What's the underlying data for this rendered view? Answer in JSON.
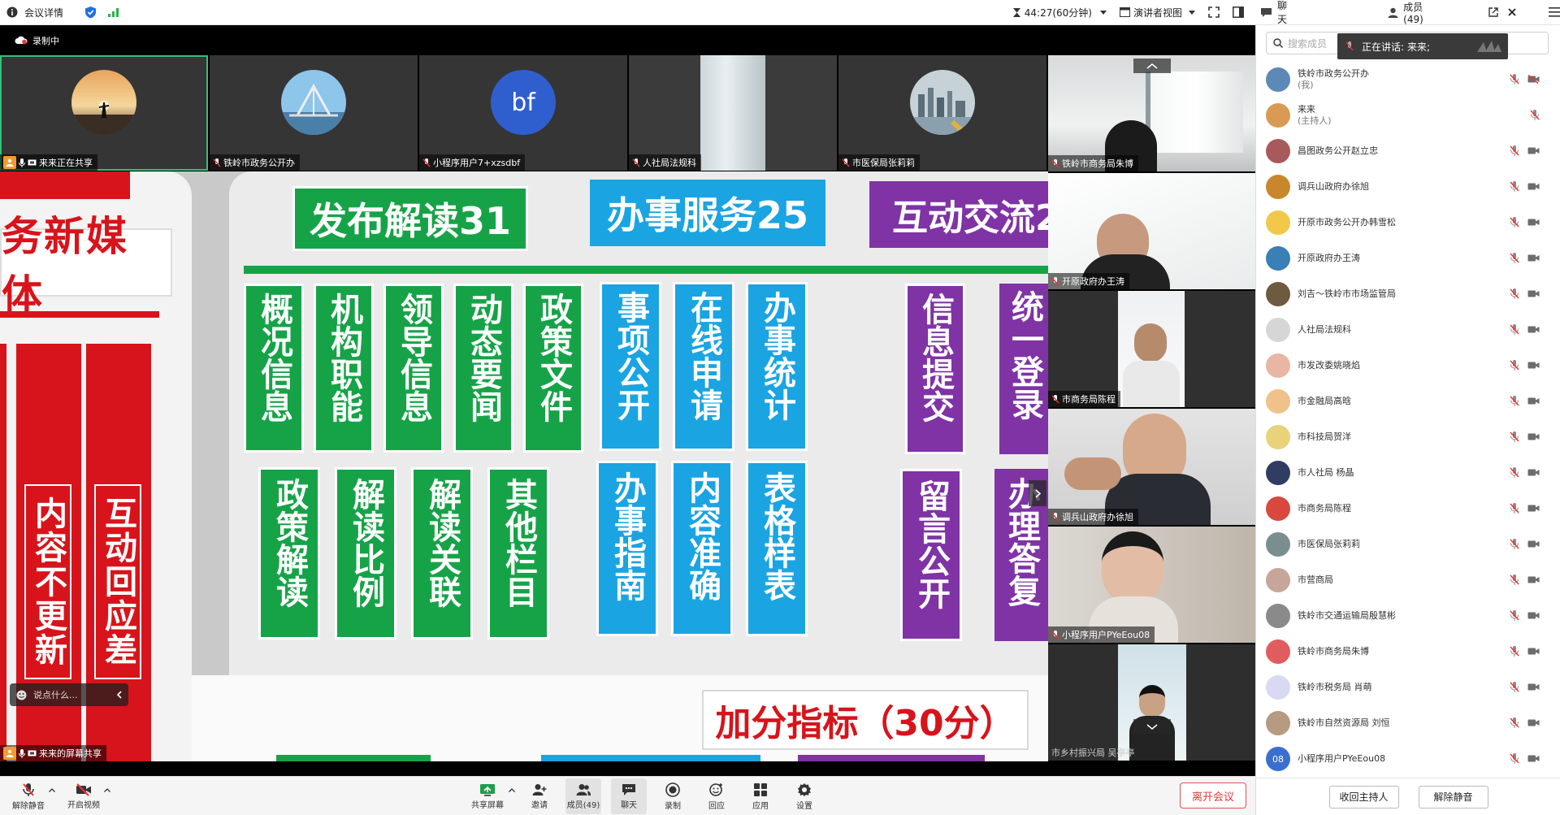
{
  "topbar": {
    "meeting_details": "会议详情",
    "timer": "44:27(60分钟)",
    "view_mode": "演讲者视图"
  },
  "tabs": {
    "chat": "聊天",
    "members": "成员(49)"
  },
  "recording_label": "录制中",
  "filmstrip": [
    {
      "name": "来来正在共享"
    },
    {
      "name": "铁岭市政务公开办"
    },
    {
      "name": "小程序用户7+xzsdbf",
      "initials": "bf"
    },
    {
      "name": "人社局法规科"
    },
    {
      "name": "市医保局张莉莉"
    }
  ],
  "right_videos": [
    {
      "name": "铁岭市商务局朱博"
    },
    {
      "name": "开原政府办王涛"
    },
    {
      "name": "市商务局陈程"
    },
    {
      "name": "调兵山政府办徐旭"
    },
    {
      "name": "小程序用户PYeEou08"
    },
    {
      "name": "市乡村振兴局 吴亭亭"
    }
  ],
  "share": {
    "header_green": "发布解读31",
    "header_blue": "办事服务25",
    "header_purple": "互动交流2",
    "left_banner": "务新媒体",
    "red_cols": [
      "内容不更新",
      "互动回应差"
    ],
    "green_top": [
      "概况信息",
      "机构职能",
      "领导信息",
      "动态要闻",
      "政策文件"
    ],
    "green_bottom": [
      "政策解读",
      "解读比例",
      "解读关联",
      "其他栏目"
    ],
    "blue_top": [
      "事项公开",
      "在线申请",
      "办事统计"
    ],
    "blue_bottom": [
      "办事指南",
      "内容准确",
      "表格样表"
    ],
    "purple_top": [
      "信息提交",
      "统一登录"
    ],
    "purple_bottom": [
      "留言公开",
      "办理答复"
    ],
    "bonus": "加分指标（30分）",
    "chat_placeholder": "说点什么...",
    "share_label": "来来的屏幕共享"
  },
  "bottombar": {
    "unmute": "解除静音",
    "video": "开启视频",
    "share_screen": "共享屏幕",
    "invite": "邀请",
    "members": "成员(49)",
    "chat": "聊天",
    "record": "录制",
    "reaction": "回应",
    "apps": "应用",
    "settings": "设置",
    "leave": "离开会议"
  },
  "members_panel": {
    "search_placeholder": "搜索成员",
    "speaking_label": "正在讲话:",
    "speaking_name": "来来;",
    "members": [
      {
        "name": "铁岭市政务公开办",
        "sub": "(我)",
        "color": "#5d89b8"
      },
      {
        "name": "来来",
        "sub": "(主持人)",
        "color": "#d89a55"
      },
      {
        "name": "昌图政务公开赵立忠",
        "sub": "",
        "color": "#a85a5a"
      },
      {
        "name": "调兵山政府办徐旭",
        "sub": "",
        "color": "#c9872b"
      },
      {
        "name": "开原市政务公开办韩雪松",
        "sub": "",
        "color": "#f2c84b"
      },
      {
        "name": "开原政府办王涛",
        "sub": "",
        "color": "#3a7fb5"
      },
      {
        "name": "刘吉～铁岭市市场监管局",
        "sub": "",
        "color": "#6d5a3f"
      },
      {
        "name": "人社局法规科",
        "sub": "",
        "color": "#d6d6d6"
      },
      {
        "name": "市发改委姚晓焰",
        "sub": "",
        "color": "#e7b7a3"
      },
      {
        "name": "市金融局高晗",
        "sub": "",
        "color": "#f0c28a"
      },
      {
        "name": "市科技局贺洋",
        "sub": "",
        "color": "#e8d27a"
      },
      {
        "name": "市人社局 杨晶",
        "sub": "",
        "color": "#2f3d63"
      },
      {
        "name": "市商务局陈程",
        "sub": "",
        "color": "#d8483f"
      },
      {
        "name": "市医保局张莉莉",
        "sub": "",
        "color": "#7a8e92"
      },
      {
        "name": "市营商局",
        "sub": "",
        "color": "#c8a59b"
      },
      {
        "name": "铁岭市交通运输局殷慧彬",
        "sub": "",
        "color": "#8a8a8a"
      },
      {
        "name": "铁岭市商务局朱博",
        "sub": "",
        "color": "#e15c5c"
      },
      {
        "name": "铁岭市税务局 肖萌",
        "sub": "",
        "color": "#d9d9f3"
      },
      {
        "name": "铁岭市自然资源局 刘恒",
        "sub": "",
        "color": "#b69a82"
      },
      {
        "name": "小程序用户PYeEou08",
        "sub": "",
        "color": "#3b6fcf",
        "initials": "08"
      }
    ],
    "reclaim_host": "收回主持人",
    "unmute_all": "解除静音"
  },
  "colors": {
    "green": "#16a347",
    "blue": "#1aa4e2",
    "purple": "#7f33a5",
    "red": "#d7141b",
    "active_tile": "#2ec276"
  }
}
